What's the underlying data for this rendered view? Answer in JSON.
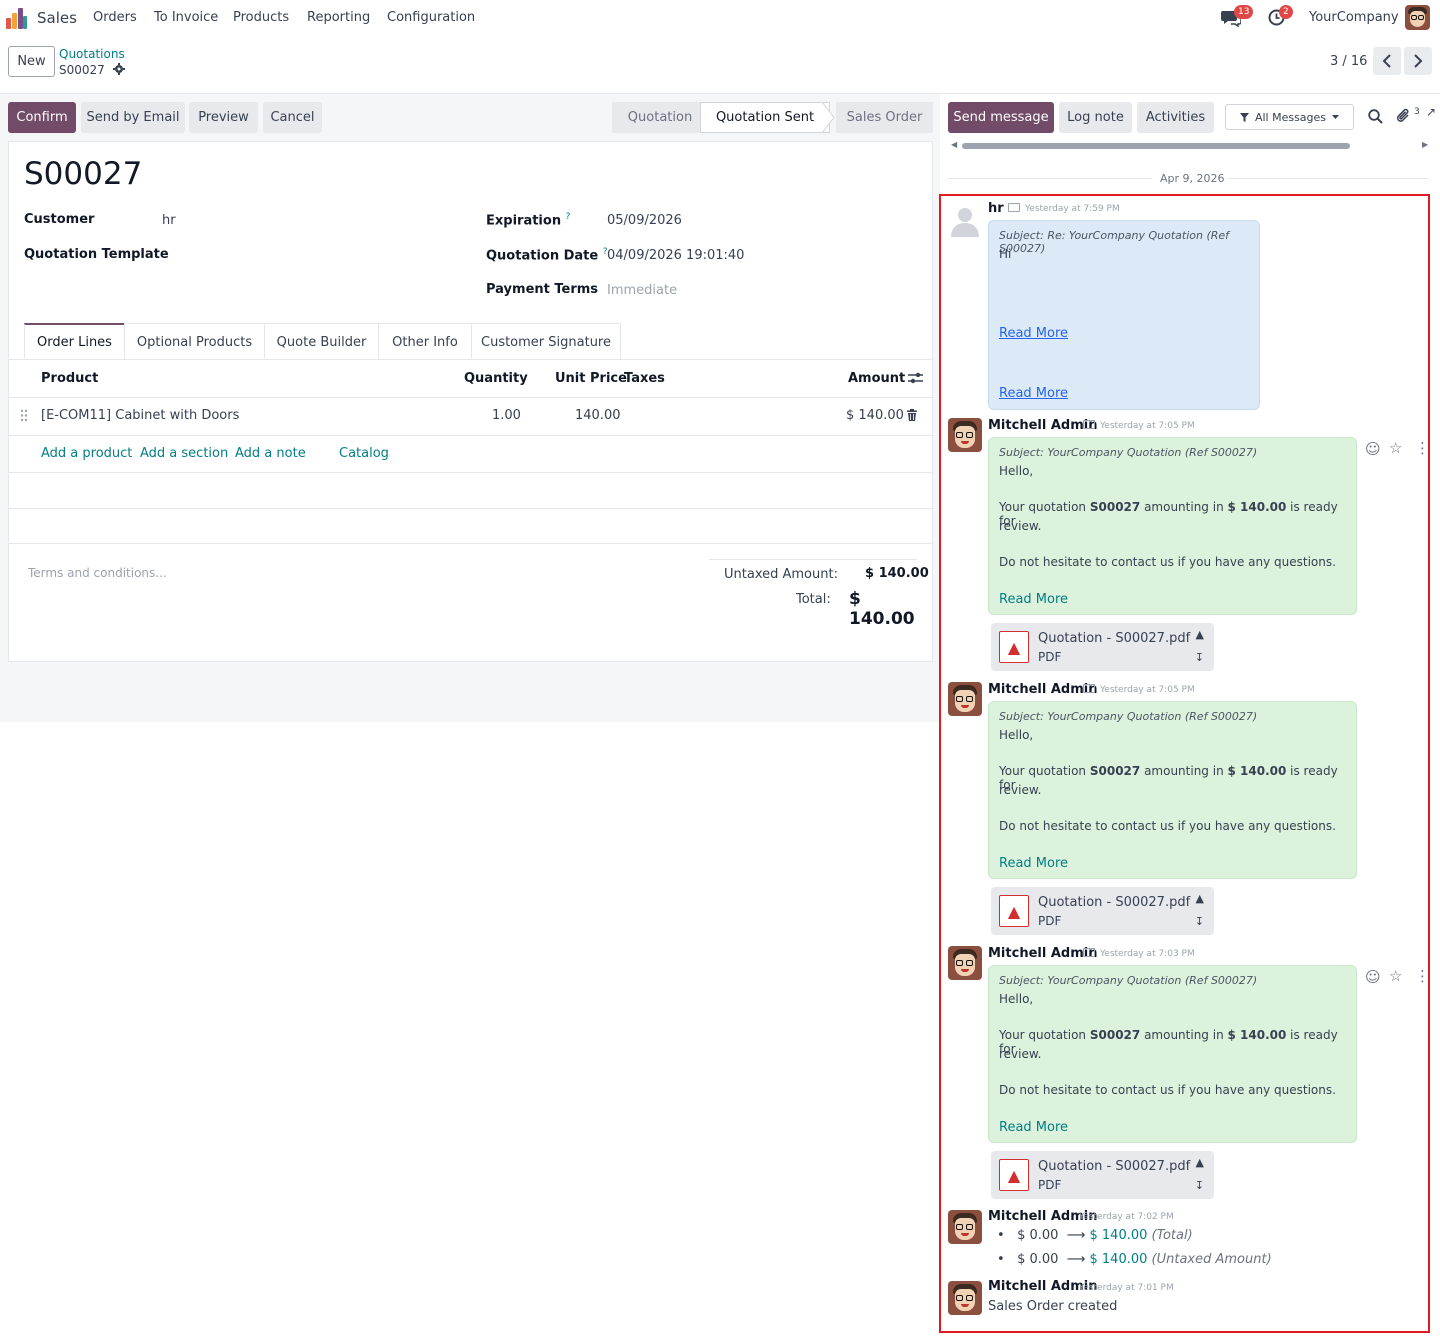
{
  "nav": {
    "app": "Sales",
    "menu": [
      "Orders",
      "To Invoice",
      "Products",
      "Reporting",
      "Configuration"
    ],
    "messages_count": "13",
    "activities_count": "2",
    "company": "YourCompany"
  },
  "control": {
    "new_label": "New",
    "breadcrumb_parent": "Quotations",
    "breadcrumb_current": "S00027",
    "pager": "3 / 16"
  },
  "actions": {
    "confirm": "Confirm",
    "send_email": "Send by Email",
    "preview": "Preview",
    "cancel": "Cancel"
  },
  "statusbar": {
    "steps": [
      "Quotation",
      "Quotation Sent",
      "Sales Order"
    ],
    "active": "Quotation Sent"
  },
  "form": {
    "title": "S00027",
    "customer_label": "Customer",
    "customer_value": "hr",
    "template_label": "Quotation Template",
    "expiration_label": "Expiration",
    "expiration_value": "05/09/2026",
    "qdate_label": "Quotation Date",
    "qdate_value": "04/09/2026 19:01:40",
    "terms_label": "Payment Terms",
    "terms_value": "Immediate",
    "help_mark": "?"
  },
  "tabs": [
    "Order Lines",
    "Optional Products",
    "Quote Builder",
    "Other Info",
    "Customer Signature"
  ],
  "lines": {
    "headers": {
      "product": "Product",
      "quantity": "Quantity",
      "unit_price": "Unit Price",
      "taxes": "Taxes",
      "amount": "Amount"
    },
    "rows": [
      {
        "product": "[E-COM11] Cabinet with Doors",
        "quantity": "1.00",
        "unit_price": "140.00",
        "amount": "$ 140.00"
      }
    ],
    "add_product": "Add a product",
    "add_section": "Add a section",
    "add_note": "Add a note",
    "catalog": "Catalog"
  },
  "totals": {
    "terms_placeholder": "Terms and conditions...",
    "untaxed_label": "Untaxed Amount:",
    "untaxed_value": "$ 140.00",
    "total_label": "Total:",
    "total_value": "$ 140.00"
  },
  "chatter": {
    "send_message": "Send message",
    "log_note": "Log note",
    "activities": "Activities",
    "filter": "All Messages",
    "attachments_count": "3",
    "date_separator": "Apr 9, 2026",
    "msg1": {
      "author": "hr",
      "time": "Yesterday at 7:59 PM",
      "subject": "Subject: Re: YourCompany Quotation (Ref S00027)",
      "body": "Hi",
      "read_more_1": "Read More",
      "read_more_2": "Read More"
    },
    "msg2": {
      "author": "Mitchell Admin",
      "time": "Yesterday at 7:05 PM",
      "subject": "Subject: YourCompany Quotation (Ref S00027)",
      "hello": "Hello,",
      "line_a": "Your quotation ",
      "order": "S00027",
      "line_b": " amounting in ",
      "amount": "$ 140.00",
      "line_c": " is ready for",
      "line_d": "review.",
      "contact": "Do not hesitate to contact us if you have any questions.",
      "read_more": "Read More",
      "file": "Quotation - S00027.pdf",
      "file_type": "PDF"
    },
    "msg3": {
      "author": "Mitchell Admin",
      "time": "Yesterday at 7:05 PM",
      "subject": "Subject: YourCompany Quotation (Ref S00027)",
      "hello": "Hello,",
      "line_a": "Your quotation ",
      "order": "S00027",
      "line_b": " amounting in ",
      "amount": "$ 140.00",
      "line_c": " is ready for",
      "line_d": "review.",
      "contact": "Do not hesitate to contact us if you have any questions.",
      "read_more": "Read More",
      "file": "Quotation - S00027.pdf",
      "file_type": "PDF"
    },
    "msg4": {
      "author": "Mitchell Admin",
      "time": "Yesterday at 7:03 PM",
      "subject": "Subject: YourCompany Quotation (Ref S00027)",
      "hello": "Hello,",
      "line_a": "Your quotation ",
      "order": "S00027",
      "line_b": " amounting in ",
      "amount": "$ 140.00",
      "line_c": " is ready for",
      "line_d": "review.",
      "contact": "Do not hesitate to contact us if you have any questions.",
      "read_more": "Read More",
      "file": "Quotation - S00027.pdf",
      "file_type": "PDF"
    },
    "msg5": {
      "author": "Mitchell Admin",
      "time": "Yesterday at 7:02 PM",
      "changes": [
        {
          "old": "$ 0.00",
          "new": "$ 140.00",
          "field": "(Total)"
        },
        {
          "old": "$ 0.00",
          "new": "$ 140.00",
          "field": "(Untaxed Amount)"
        }
      ]
    },
    "msg6": {
      "author": "Mitchell Admin",
      "time": "Yesterday at 7:01 PM",
      "body": "Sales Order created"
    }
  },
  "colors": {
    "primary": "#714b67",
    "link": "#017e84",
    "highlight_border": "#e01b24"
  }
}
